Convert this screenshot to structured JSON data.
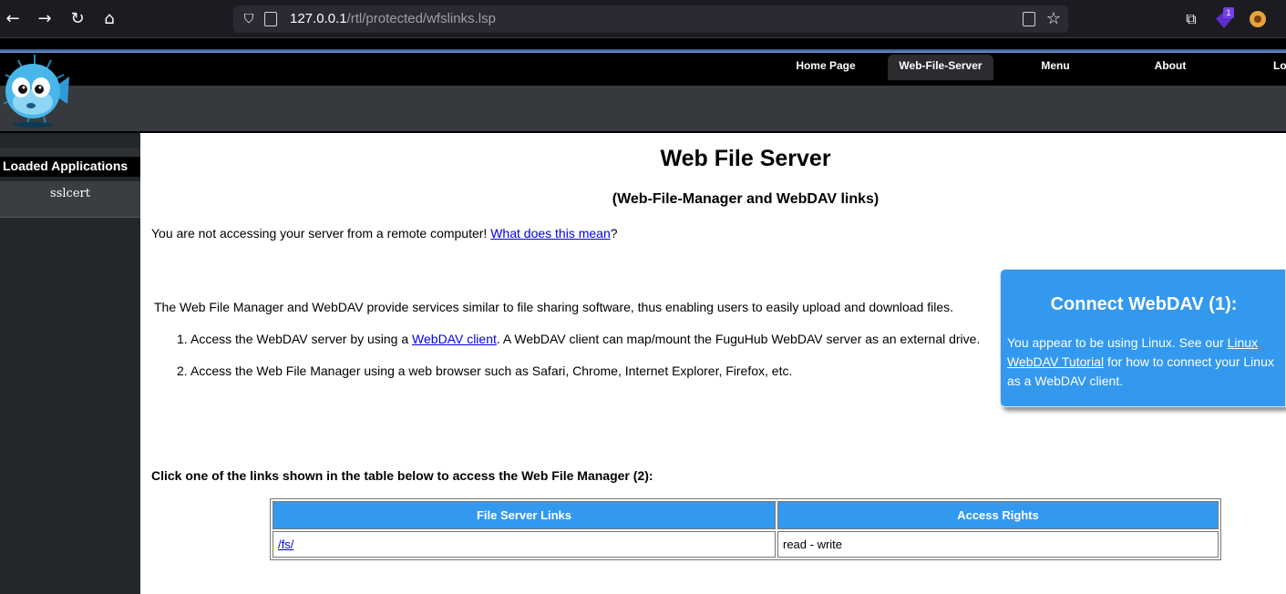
{
  "browser": {
    "url_host": "127.0.0.1",
    "url_path": "/rtl/protected/wfslinks.lsp",
    "extension_badge": "1",
    "icons": [
      "back-icon",
      "forward-icon",
      "reload-icon",
      "home-icon",
      "shield-icon",
      "page-icon",
      "reader-icon",
      "star-icon",
      "extensions-icon"
    ]
  },
  "nav": {
    "items": [
      {
        "label": "Home Page"
      },
      {
        "label": "Web-File-Server"
      },
      {
        "label": "Menu"
      },
      {
        "label": "About"
      },
      {
        "label": "Log"
      }
    ],
    "active": "Web-File-Server"
  },
  "sidebar": {
    "title": "Loaded Applications",
    "items": [
      {
        "label": "sslcert"
      }
    ]
  },
  "main": {
    "title": "Web File Server",
    "subtitle": "(Web-File-Manager and WebDAV links)",
    "notice_text": "You are not accessing your server from a remote computer! ",
    "notice_link": "What does this mean",
    "notice_end": "?",
    "intro": "The Web File Manager and WebDAV provide services similar to file sharing software, thus enabling users to easily upload and download files.",
    "steps": [
      {
        "num": "1.",
        "before": "Access the WebDAV server by using a ",
        "link": "WebDAV client",
        "after": ". A WebDAV client can map/mount the FuguHub WebDAV server as an external drive."
      },
      {
        "num": "2.",
        "text": "Access the Web File Manager using a web browser such as Safari, Chrome, Internet Explorer, Firefox, etc."
      }
    ],
    "table_lead": "Click one of the links shown in the table below to access the Web File Manager (2):",
    "table": {
      "headers": [
        "File Server Links",
        "Access Rights"
      ],
      "rows": [
        [
          "/fs/",
          "read - write"
        ]
      ]
    }
  },
  "webdav": {
    "title": "Connect WebDAV (1):",
    "text_before": "You appear to be using Linux. See our ",
    "link": "Linux WebDAV Tutorial",
    "text_after": " for how to connect your Linux as a WebDAV client."
  },
  "colors": {
    "accent": "#3399ee",
    "link": "#0000ee",
    "sidebar_bg": "#24272a"
  }
}
